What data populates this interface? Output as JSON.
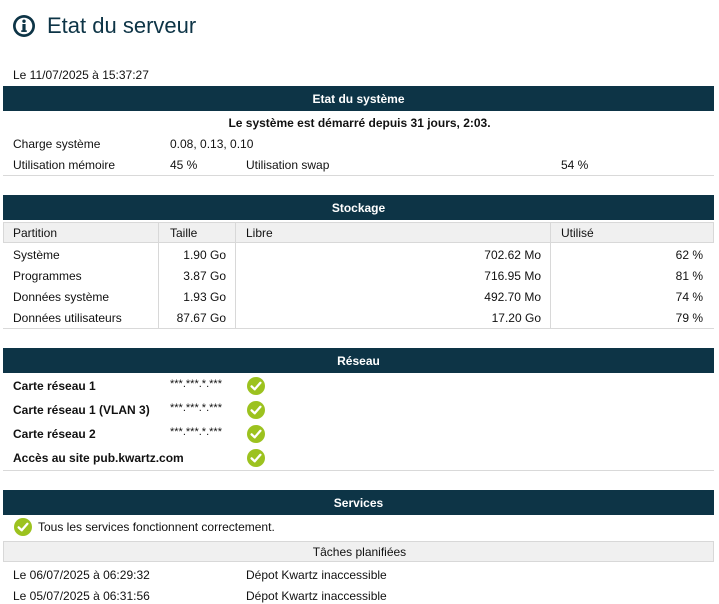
{
  "header": {
    "title": "Etat du serveur",
    "icon": "info-icon",
    "accent": "#0d3446"
  },
  "timestamp": "Le 11/07/2025 à 15:37:27",
  "system": {
    "heading": "Etat du système",
    "uptime": "Le système est démarré depuis 31 jours, 2:03.",
    "load_label": "Charge système",
    "load_value": "0.08, 0.13, 0.10",
    "mem_label": "Utilisation mémoire",
    "mem_value": "45 %",
    "swap_label": "Utilisation swap",
    "swap_value": "54 %"
  },
  "storage": {
    "heading": "Stockage",
    "columns": [
      "Partition",
      "Taille",
      "Libre",
      "Utilisé"
    ],
    "rows": [
      {
        "partition": "Système",
        "size": "1.90 Go",
        "free": "702.62 Mo",
        "used": "62 %"
      },
      {
        "partition": "Programmes",
        "size": "3.87 Go",
        "free": "716.95 Mo",
        "used": "81 %"
      },
      {
        "partition": "Données système",
        "size": "1.93 Go",
        "free": "492.70 Mo",
        "used": "74 %"
      },
      {
        "partition": "Données utilisateurs",
        "size": "87.67 Go",
        "free": "17.20 Go",
        "used": "79 %"
      }
    ]
  },
  "network": {
    "heading": "Réseau",
    "rows": [
      {
        "label": "Carte réseau 1",
        "ip": "***.***.*.***",
        "status": "check-icon"
      },
      {
        "label": "Carte réseau 1 (VLAN 3)",
        "ip": "***.***.*.***",
        "status": "check-icon"
      },
      {
        "label": "Carte réseau 2",
        "ip": "***.***.*.***",
        "status": "check-icon"
      },
      {
        "label": "Accès au site pub.kwartz.com",
        "ip": "",
        "status": "check-icon"
      }
    ]
  },
  "services": {
    "heading": "Services",
    "status_text": "Tous les services fonctionnent correctement.",
    "scheduled_heading": "Tâches planifiées",
    "tasks": [
      {
        "date": "Le 06/07/2025 à 06:29:32",
        "message": "Dépot Kwartz inaccessible"
      },
      {
        "date": "Le 05/07/2025 à 06:31:56",
        "message": "Dépot Kwartz inaccessible"
      }
    ]
  },
  "colors": {
    "header_bg": "#0d3446",
    "check_green": "#9cc21f",
    "subheader_bg": "#f0f0f0"
  }
}
